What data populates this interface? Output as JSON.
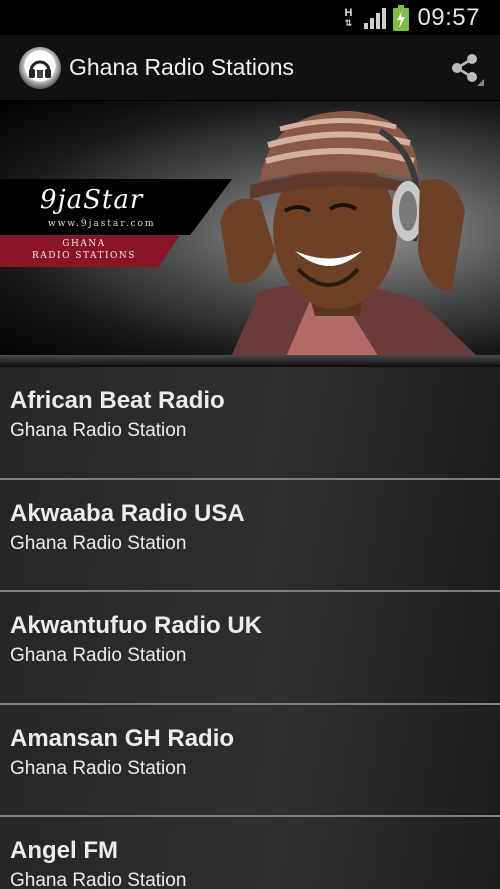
{
  "status_bar": {
    "network_indicator": "H",
    "clock": "09:57"
  },
  "action_bar": {
    "title": "Ghana Radio Stations",
    "share_icon": "share-icon"
  },
  "banner": {
    "brand": "9jaStar",
    "url": "www.9jastar.com",
    "ribbon_line1": "GHANA",
    "ribbon_line2": "RADIO STATIONS"
  },
  "stations": [
    {
      "name": "African Beat Radio",
      "subtitle": "Ghana Radio Station"
    },
    {
      "name": "Akwaaba Radio USA",
      "subtitle": "Ghana Radio Station"
    },
    {
      "name": "Akwantufuo Radio UK",
      "subtitle": "Ghana Radio Station"
    },
    {
      "name": "Amansan GH Radio",
      "subtitle": "Ghana Radio Station"
    },
    {
      "name": "Angel FM",
      "subtitle": "Ghana Radio Station"
    }
  ],
  "colors": {
    "ribbon": "#8c1428",
    "list_divider": "#7e7e7e",
    "battery": "#7ac143"
  }
}
